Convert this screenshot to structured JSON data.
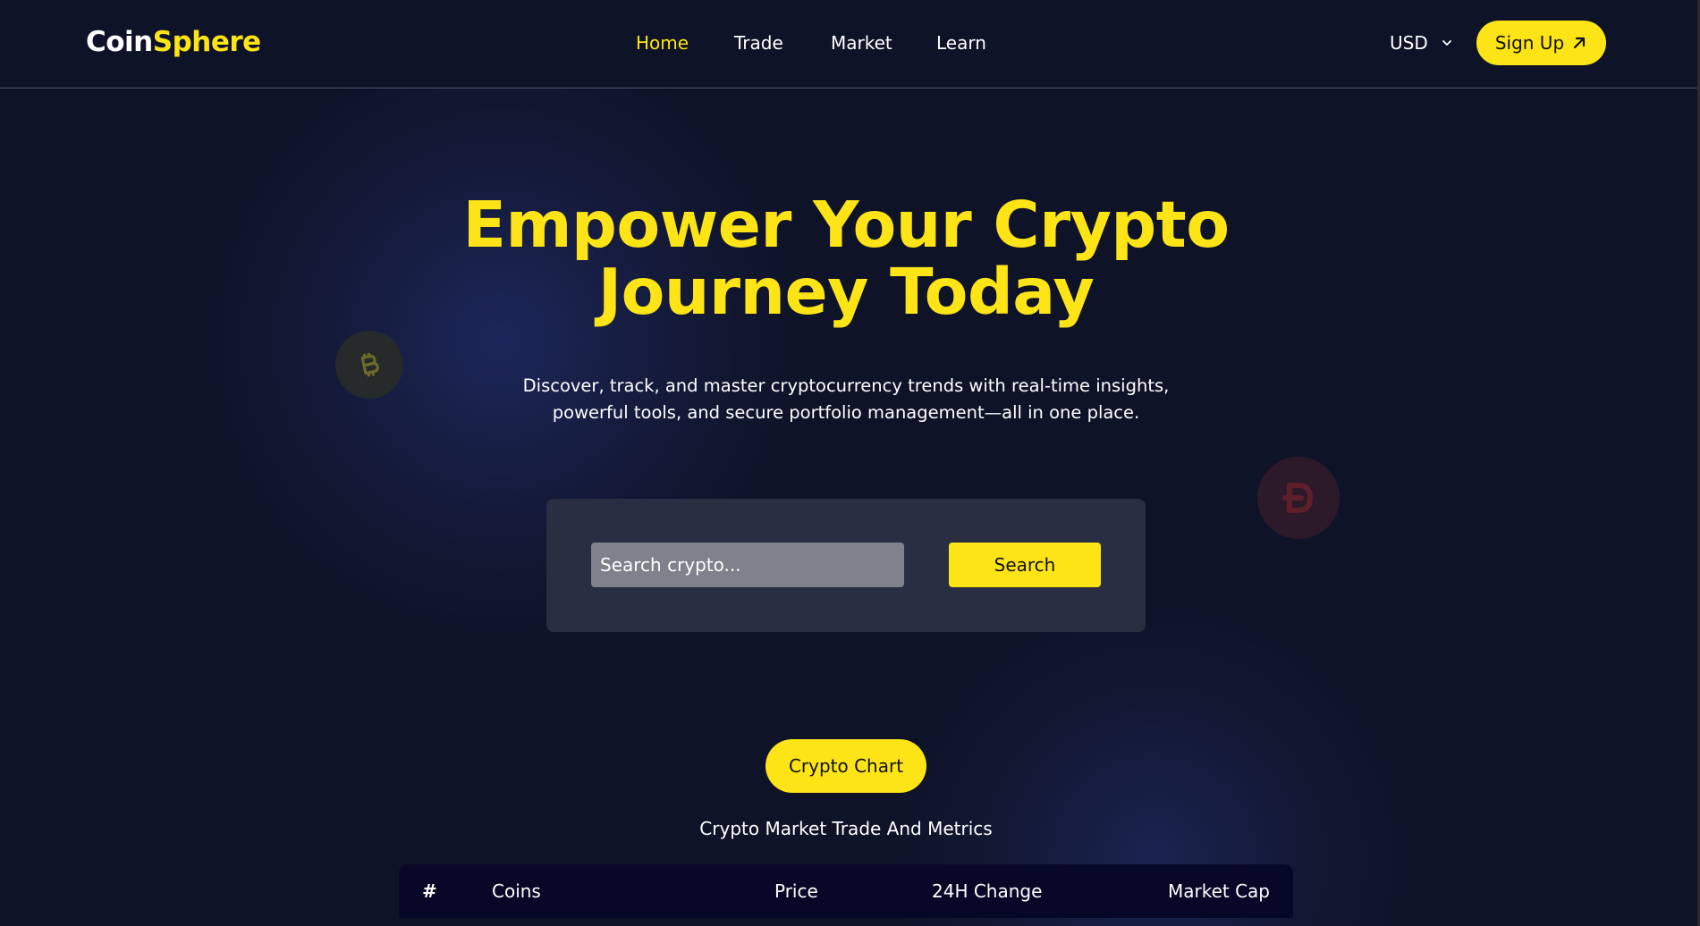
{
  "header": {
    "logo_part1": "Coin",
    "logo_part2": "Sphere",
    "nav": [
      {
        "label": "Home",
        "active": true
      },
      {
        "label": "Trade",
        "active": false
      },
      {
        "label": "Market",
        "active": false
      },
      {
        "label": "Learn",
        "active": false
      }
    ],
    "currency": "USD",
    "signup_label": "Sign Up"
  },
  "hero": {
    "title_line1": "Empower Your Crypto",
    "title_line2": "Journey Today",
    "subtitle_line1": "Discover, track, and master cryptocurrency trends with real-time insights,",
    "subtitle_line2": "powerful tools, and secure portfolio management—all in one place."
  },
  "search": {
    "placeholder": "Search crypto...",
    "button_label": "Search"
  },
  "market": {
    "pill_label": "Crypto Chart",
    "subtitle": "Crypto Market Trade And Metrics",
    "columns": [
      "#",
      "Coins",
      "Price",
      "24H Change",
      "Market Cap"
    ]
  },
  "colors": {
    "background": "#0f1328",
    "accent": "#fde416",
    "panel": "#2a2e42",
    "table_header": "#070727"
  },
  "icons": {
    "signup": "arrow-up-right-icon",
    "currency": "chevron-down-icon",
    "coin_left": "bitcoin-icon",
    "coin_right": "dogecoin-icon"
  }
}
